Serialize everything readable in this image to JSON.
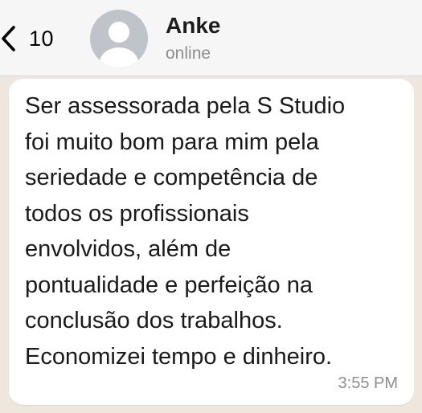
{
  "header": {
    "back_count": "10",
    "contact_name": "Anke",
    "contact_status": "online",
    "icons": {
      "back": "chevron-left-icon",
      "avatar": "person-silhouette-icon"
    }
  },
  "message": {
    "lines": [
      "Ser assessorada pela S Studio",
      "foi muito bom para mim pela",
      "seriedade e competência de",
      "todos os profissionais",
      "envolvidos, além de",
      "pontualidade e perfeição na",
      "conclusão dos trabalhos.",
      "Economizei tempo e dinheiro."
    ],
    "time": "3:55 PM"
  },
  "colors": {
    "header_bg": "#f6f6f6",
    "chat_bg": "#efe7dd",
    "bubble_bg": "#ffffff",
    "avatar_bg": "#bfc4cb"
  }
}
